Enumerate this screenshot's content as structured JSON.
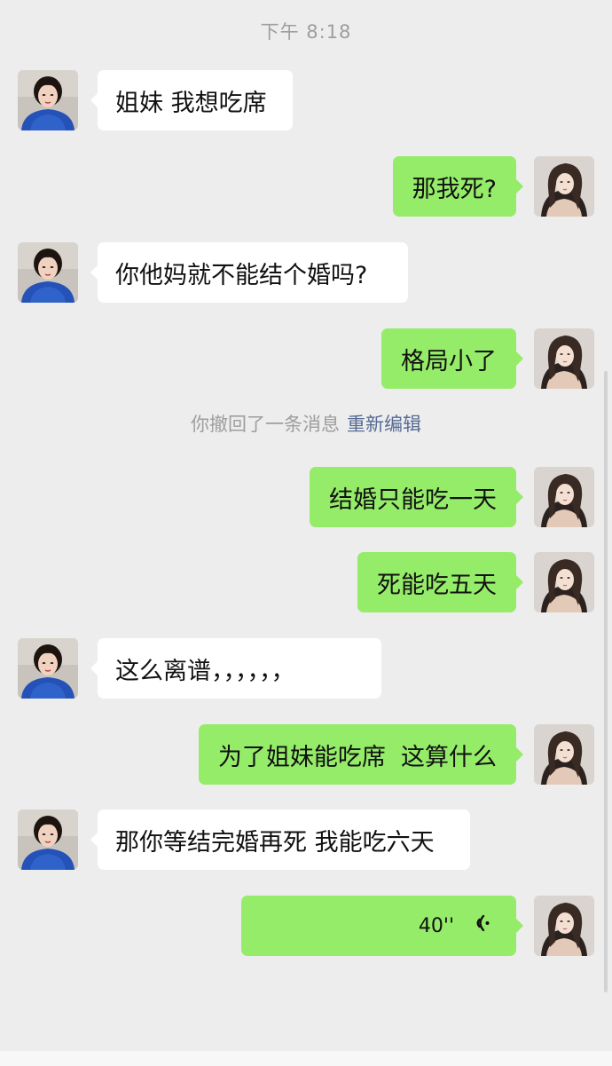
{
  "header": {
    "timestamp": "下午 8:18"
  },
  "contacts": {
    "friend_avatar": "avatar-friend",
    "self_avatar": "avatar-self"
  },
  "messages": [
    {
      "side": "in",
      "text": "姐妹 我想吃席"
    },
    {
      "side": "out",
      "text": "那我死?"
    },
    {
      "side": "in",
      "text": "你他妈就不能结个婚吗?"
    },
    {
      "side": "out",
      "text": "格局小了"
    },
    {
      "side": "out",
      "text": "结婚只能吃一天"
    },
    {
      "side": "out",
      "text": "死能吃五天"
    },
    {
      "side": "in",
      "text": "这么离谱，，，，，，"
    },
    {
      "side": "out",
      "text": "为了姐妹能吃席  这算什么"
    },
    {
      "side": "in",
      "text": "那你等结完婚再死 我能吃六天"
    },
    {
      "side": "out",
      "type": "voice",
      "duration": "40''"
    }
  ],
  "recall_notice": {
    "text": "你撤回了一条消息",
    "action": "重新编辑"
  },
  "colors": {
    "background": "#ededed",
    "incoming_bubble": "#ffffff",
    "outgoing_bubble": "#95ec69",
    "link": "#576b95",
    "meta_text": "#9e9e9e"
  }
}
